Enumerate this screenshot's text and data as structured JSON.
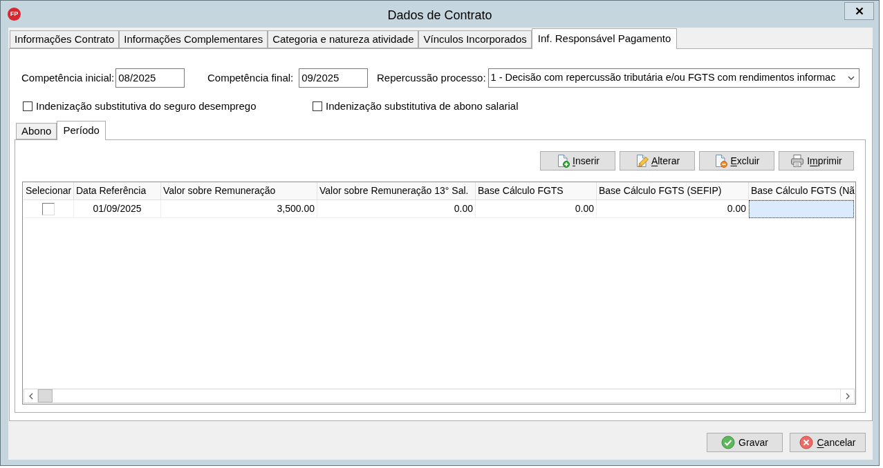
{
  "window": {
    "logo_text": "FP",
    "title": "Dados de Contrato"
  },
  "tabs": [
    {
      "label": "Informações Contrato",
      "selected": false
    },
    {
      "label": "Informações Complementares",
      "selected": false
    },
    {
      "label": "Categoria e natureza atividade",
      "selected": false
    },
    {
      "label": "Vínculos Incorporados",
      "selected": false
    },
    {
      "label": "Inf. Responsável Pagamento",
      "selected": true
    }
  ],
  "form": {
    "fields": [
      {
        "kind": "text",
        "label": "Competência inicial:",
        "value": "08/2025"
      },
      {
        "kind": "text",
        "label": "Competência final:",
        "value": "09/2025"
      },
      {
        "kind": "select",
        "label": "Repercussão processo:",
        "value": "1 - Decisão com repercussão tributária e/ou FGTS com rendimentos informac"
      }
    ],
    "checkboxes": [
      {
        "label": "Indenização substitutiva do seguro desemprego",
        "checked": false
      },
      {
        "label": "Indenização substitutiva de abono salarial",
        "checked": false
      }
    ]
  },
  "sub_tabs": [
    {
      "label": "Abono",
      "selected": false
    },
    {
      "label": "Período",
      "selected": true
    }
  ],
  "toolbar_buttons": [
    {
      "kind": "insert",
      "label": [
        {
          "text": "I",
          "underline": true
        },
        {
          "text": "nserir",
          "underline": false
        }
      ]
    },
    {
      "kind": "edit",
      "label": [
        {
          "text": "A",
          "underline": true
        },
        {
          "text": "lterar",
          "underline": false
        }
      ]
    },
    {
      "kind": "delete",
      "label": [
        {
          "text": "E",
          "underline": true
        },
        {
          "text": "xcluir",
          "underline": false
        }
      ]
    },
    {
      "kind": "print",
      "label": [
        {
          "text": "I",
          "underline": false
        },
        {
          "text": "m",
          "underline": true
        },
        {
          "text": "primir",
          "underline": false
        }
      ]
    }
  ],
  "grid": {
    "columns": [
      "Selecionar",
      "Data Referência",
      "Valor sobre Remuneração",
      "Valor sobre Remuneração 13° Sal.",
      "Base Cálculo FGTS",
      "Base Cálculo FGTS (SEFIP)",
      "Base Cálculo FGTS (Nã"
    ],
    "rows": [
      {
        "cells": [
          {
            "kind": "checkbox",
            "checked": false,
            "selected": false
          },
          {
            "kind": "text",
            "text": "01/09/2025",
            "selected": false
          },
          {
            "kind": "text",
            "text": "3,500.00",
            "selected": false
          },
          {
            "kind": "text",
            "text": "0.00",
            "selected": false
          },
          {
            "kind": "text",
            "text": "0.00",
            "selected": false
          },
          {
            "kind": "text",
            "text": "0.00",
            "selected": false
          },
          {
            "kind": "text",
            "selected": true
          }
        ]
      }
    ]
  },
  "footer_buttons": [
    {
      "kind": "save",
      "label": [
        {
          "text": "Gravar",
          "underline": false
        }
      ]
    },
    {
      "kind": "cancel",
      "label": [
        {
          "text": "C",
          "underline": true
        },
        {
          "text": "ancelar",
          "underline": false
        }
      ]
    }
  ]
}
